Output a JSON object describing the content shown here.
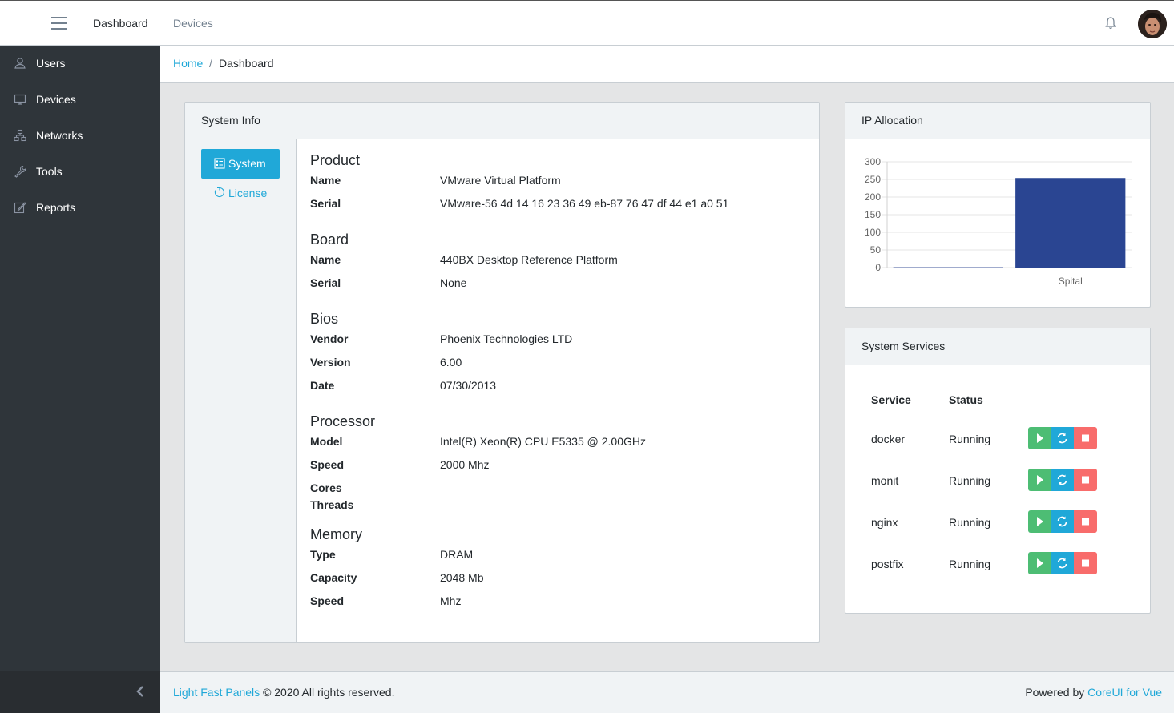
{
  "header": {
    "nav": {
      "dashboard": "Dashboard",
      "devices": "Devices"
    }
  },
  "sidebar": {
    "items": [
      {
        "label": "Users",
        "icon": "user-icon"
      },
      {
        "label": "Devices",
        "icon": "monitor-icon"
      },
      {
        "label": "Networks",
        "icon": "sitemap-icon"
      },
      {
        "label": "Tools",
        "icon": "wrench-icon"
      },
      {
        "label": "Reports",
        "icon": "note-icon"
      }
    ]
  },
  "breadcrumb": {
    "home": "Home",
    "separator": "/",
    "current": "Dashboard"
  },
  "system_info": {
    "title": "System Info",
    "tabs": {
      "system": "System",
      "license": "License"
    },
    "product": {
      "title": "Product",
      "name_label": "Name",
      "name": "VMware Virtual Platform",
      "serial_label": "Serial",
      "serial": "VMware-56 4d 14 16 23 36 49 eb-87 76 47 df 44 e1 a0 51"
    },
    "board": {
      "title": "Board",
      "name_label": "Name",
      "name": "440BX Desktop Reference Platform",
      "serial_label": "Serial",
      "serial": "None"
    },
    "bios": {
      "title": "Bios",
      "vendor_label": "Vendor",
      "vendor": "Phoenix Technologies LTD",
      "version_label": "Version",
      "version": "6.00",
      "date_label": "Date",
      "date": "07/30/2013"
    },
    "processor": {
      "title": "Processor",
      "model_label": "Model",
      "model": "Intel(R) Xeon(R) CPU E5335 @ 2.00GHz",
      "speed_label": "Speed",
      "speed": "2000 Mhz",
      "cores_label": "Cores",
      "threads_label": "Threads"
    },
    "memory": {
      "title": "Memory",
      "type_label": "Type",
      "type": "DRAM",
      "capacity_label": "Capacity",
      "capacity": "2048 Mb",
      "speed_label": "Speed",
      "speed": "Mhz"
    }
  },
  "ip_allocation": {
    "title": "IP Allocation"
  },
  "chart_data": {
    "type": "bar",
    "categories": [
      "",
      "Spital"
    ],
    "values": [
      1,
      254
    ],
    "yticks": [
      0,
      50,
      100,
      150,
      200,
      250,
      300
    ],
    "ylim": [
      0,
      300
    ],
    "color": "#2a4592",
    "grid": true
  },
  "system_services": {
    "title": "System Services",
    "headers": {
      "service": "Service",
      "status": "Status"
    },
    "rows": [
      {
        "service": "docker",
        "status": "Running"
      },
      {
        "service": "monit",
        "status": "Running"
      },
      {
        "service": "nginx",
        "status": "Running"
      },
      {
        "service": "postfix",
        "status": "Running"
      }
    ]
  },
  "footer": {
    "brand": "Light Fast Panels",
    "copyright": "© 2020 All rights reserved.",
    "powered_by": "Powered by",
    "framework": "CoreUI for Vue"
  },
  "colors": {
    "primary": "#20a8d8",
    "success": "#4dbd74",
    "danger": "#f86c6b",
    "sidebar": "#2f353a"
  }
}
